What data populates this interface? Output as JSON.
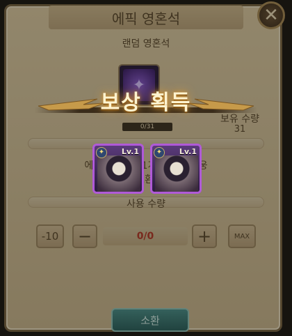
{
  "window": {
    "title": "에픽 영혼석",
    "close_glyph": "✕"
  },
  "item": {
    "name": "랜덤 영혼석",
    "progress_text": "0/31",
    "owned_label": "보유 수량",
    "owned_count": "31"
  },
  "description": {
    "line1": "에픽 영혼석 31개로 에픽 영웅",
    "line2": "1명 소환 가능"
  },
  "usage": {
    "label": "사용 수량",
    "minus10": "-10",
    "minus": "−",
    "quantity": "0/0",
    "plus": "+",
    "max": "MAX"
  },
  "summon_button": "소환",
  "reward_popup": {
    "title": "보상 획득",
    "cards": [
      {
        "level": "Lv.1",
        "icon": "hero-portrait-icon"
      },
      {
        "level": "Lv.1",
        "icon": "hero-portrait-icon"
      }
    ]
  },
  "colors": {
    "panel": "#d9c7a0",
    "card_border": "#b05ad8",
    "summon": "#3a7a74"
  }
}
